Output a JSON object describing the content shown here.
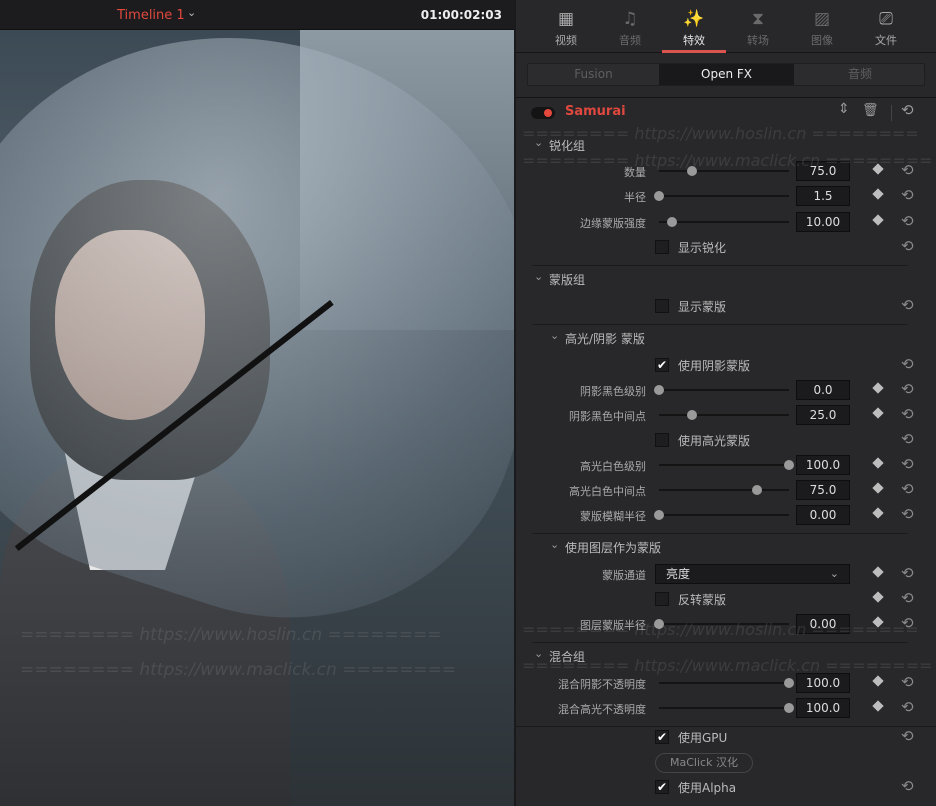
{
  "viewer": {
    "timeline_name": "Timeline 1",
    "timecode": "01:00:02:03"
  },
  "watermarks": {
    "hoslin": "======== https://www.hoslin.cn ========",
    "maclick": "======== https://www.maclick.cn ========"
  },
  "tabs": [
    {
      "label": "视频",
      "icon": "film-icon",
      "glyph": "▦"
    },
    {
      "label": "音频",
      "icon": "music-note-icon",
      "glyph": "♫"
    },
    {
      "label": "特效",
      "icon": "magic-wand-icon",
      "glyph": "✨"
    },
    {
      "label": "转场",
      "icon": "transition-icon",
      "glyph": "⧗"
    },
    {
      "label": "图像",
      "icon": "image-icon",
      "glyph": "▨"
    },
    {
      "label": "文件",
      "icon": "camera-file-icon",
      "glyph": "⎚"
    }
  ],
  "active_tab": "特效",
  "subtabs": [
    "Fusion",
    "Open FX",
    "音频"
  ],
  "active_subtab": "Open FX",
  "effect": {
    "name": "Samurai",
    "enabled": true,
    "accent": "#e0483e"
  },
  "rows": [
    {
      "type": "group",
      "label": "锐化组"
    },
    {
      "type": "slider",
      "label": "数量",
      "value": "75.0",
      "level": 0.25
    },
    {
      "type": "slider",
      "label": "半径",
      "value": "1.5",
      "level": 0.0
    },
    {
      "type": "slider",
      "label": "边缘蒙版强度",
      "value": "10.00",
      "level": 0.1
    },
    {
      "type": "checkbox",
      "label": "显示锐化",
      "checked": false
    },
    {
      "type": "divider"
    },
    {
      "type": "group",
      "label": "蒙版组"
    },
    {
      "type": "checkbox",
      "label": "显示蒙版",
      "checked": false
    },
    {
      "type": "divider"
    },
    {
      "type": "subgroup",
      "label": "高光/阴影 蒙版"
    },
    {
      "type": "checkbox",
      "label": "使用阴影蒙版",
      "checked": true
    },
    {
      "type": "slider",
      "label": "阴影黑色级别",
      "value": "0.0",
      "level": 0.0
    },
    {
      "type": "slider",
      "label": "阴影黑色中间点",
      "value": "25.0",
      "level": 0.25
    },
    {
      "type": "checkbox",
      "label": "使用高光蒙版",
      "checked": false
    },
    {
      "type": "slider",
      "label": "高光白色级别",
      "value": "100.0",
      "level": 1.0
    },
    {
      "type": "slider",
      "label": "高光白色中间点",
      "value": "75.0",
      "level": 0.75
    },
    {
      "type": "slider",
      "label": "蒙版模糊半径",
      "value": "0.00",
      "level": 0.0
    },
    {
      "type": "divider"
    },
    {
      "type": "subgroup",
      "label": "使用图层作为蒙版"
    },
    {
      "type": "dropdown",
      "label": "蒙版通道",
      "value": "亮度"
    },
    {
      "type": "checkbox",
      "label": "反转蒙版",
      "checked": false,
      "keyframe": true
    },
    {
      "type": "slider",
      "label": "图层蒙版半径",
      "value": "0.00",
      "level": 0.0
    },
    {
      "type": "divider"
    },
    {
      "type": "group",
      "label": "混合组"
    },
    {
      "type": "slider",
      "label": "混合阴影不透明度",
      "value": "100.0",
      "level": 1.0
    },
    {
      "type": "slider",
      "label": "混合高光不透明度",
      "value": "100.0",
      "level": 1.0
    },
    {
      "type": "divider",
      "full": true
    },
    {
      "type": "checkbox",
      "label": "使用GPU",
      "checked": true
    },
    {
      "type": "button",
      "label": "MaClick 汉化"
    },
    {
      "type": "checkbox",
      "label": "使用Alpha",
      "checked": true
    }
  ]
}
